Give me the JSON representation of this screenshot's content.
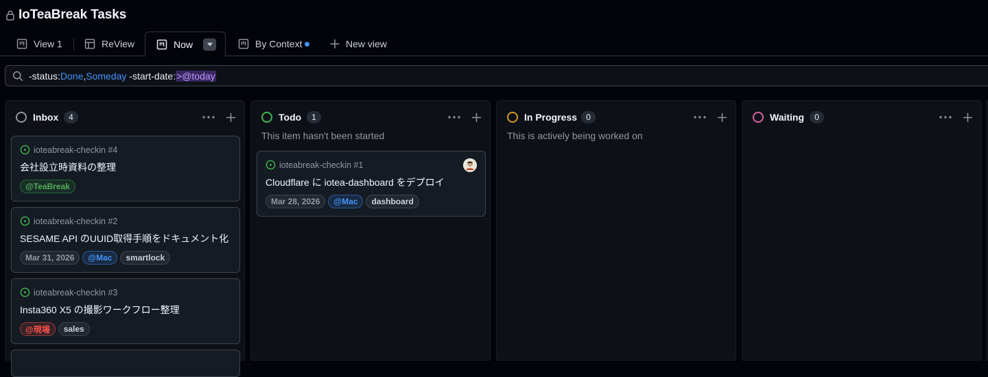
{
  "project": {
    "title": "IoTeaBreak Tasks",
    "lock_icon": "lock-icon"
  },
  "tabs": [
    {
      "label": "View 1",
      "icon": "board-icon",
      "active": false
    },
    {
      "label": "ReView",
      "icon": "table-icon",
      "active": false
    },
    {
      "label": "Now",
      "icon": "board-icon",
      "active": true
    },
    {
      "label": "By Context",
      "icon": "board-icon",
      "active": false,
      "unsaved_dot": true
    },
    {
      "label": "New view",
      "icon": "plus-icon",
      "active": false
    }
  ],
  "filter": {
    "parts": [
      "-status:",
      "Done",
      ",",
      "Someday",
      " -start-date:",
      ">@today"
    ]
  },
  "colors": {
    "inbox": "#9198a1",
    "todo": "#3fb950",
    "in_progress": "#d29922",
    "waiting": "#db61a2",
    "accent": "#4493f8"
  },
  "columns": [
    {
      "name": "Inbox",
      "count": "4",
      "description": "",
      "cards": [
        {
          "ref": "ioteabreak-checkin #4",
          "title": "会社設立時資料の整理",
          "labels": [
            {
              "text": "@TeaBreak",
              "kind": "teabreak"
            }
          ]
        },
        {
          "ref": "ioteabreak-checkin #2",
          "title": "SESAME API のUUID取得手順をドキュメント化",
          "labels": [
            {
              "text": "Mar 31, 2026",
              "kind": "date"
            },
            {
              "text": "@Mac",
              "kind": "mac"
            },
            {
              "text": "smartlock",
              "kind": "plain"
            }
          ]
        },
        {
          "ref": "ioteabreak-checkin #3",
          "title": "Insta360 X5 の撮影ワークフロー整理",
          "labels": [
            {
              "text": "@現場",
              "kind": "genba"
            },
            {
              "text": "sales",
              "kind": "plain"
            }
          ]
        }
      ]
    },
    {
      "name": "Todo",
      "count": "1",
      "description": "This item hasn't been started",
      "cards": [
        {
          "ref": "ioteabreak-checkin #1",
          "title": "Cloudflare に iotea-dashboard をデプロイ",
          "labels": [
            {
              "text": "Mar 28, 2026",
              "kind": "date"
            },
            {
              "text": "@Mac",
              "kind": "mac"
            },
            {
              "text": "dashboard",
              "kind": "plain"
            }
          ]
        }
      ]
    },
    {
      "name": "In Progress",
      "count": "0",
      "description": "This is actively being worked on",
      "cards": []
    },
    {
      "name": "Waiting",
      "count": "0",
      "description": "",
      "cards": []
    }
  ]
}
